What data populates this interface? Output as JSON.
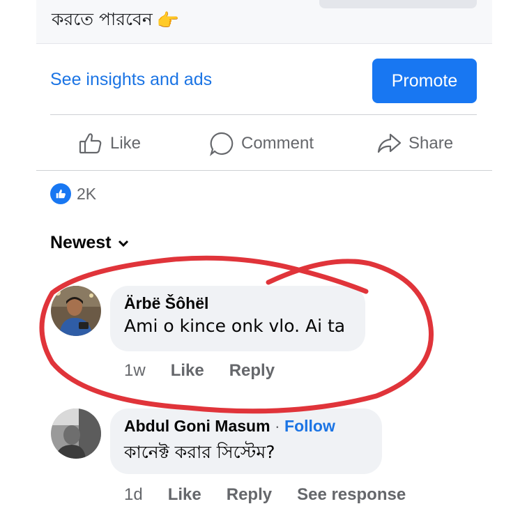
{
  "post": {
    "text_tail": "করতে পারবেন",
    "hand_emoji": "👉"
  },
  "insights": {
    "link_label": "See insights and ads",
    "promote_label": "Promote"
  },
  "actions": {
    "like": "Like",
    "comment": "Comment",
    "share": "Share"
  },
  "reactions": {
    "count": "2K"
  },
  "sort": {
    "label": "Newest"
  },
  "comments": [
    {
      "author": "Ärbë Šôhël",
      "text": "Ami o kince onk vlo. Ai ta",
      "time": "1w",
      "like": "Like",
      "reply": "Reply"
    },
    {
      "author": "Abdul Goni Masum",
      "follow": "Follow",
      "separator": "·",
      "text": "কানেক্ট করার সিস্টেম?",
      "time": "1d",
      "like": "Like",
      "reply": "Reply",
      "see_response": "See response"
    }
  ],
  "colors": {
    "accent": "#1877f2",
    "link": "#1b74e4",
    "annotation": "#e0343a"
  }
}
